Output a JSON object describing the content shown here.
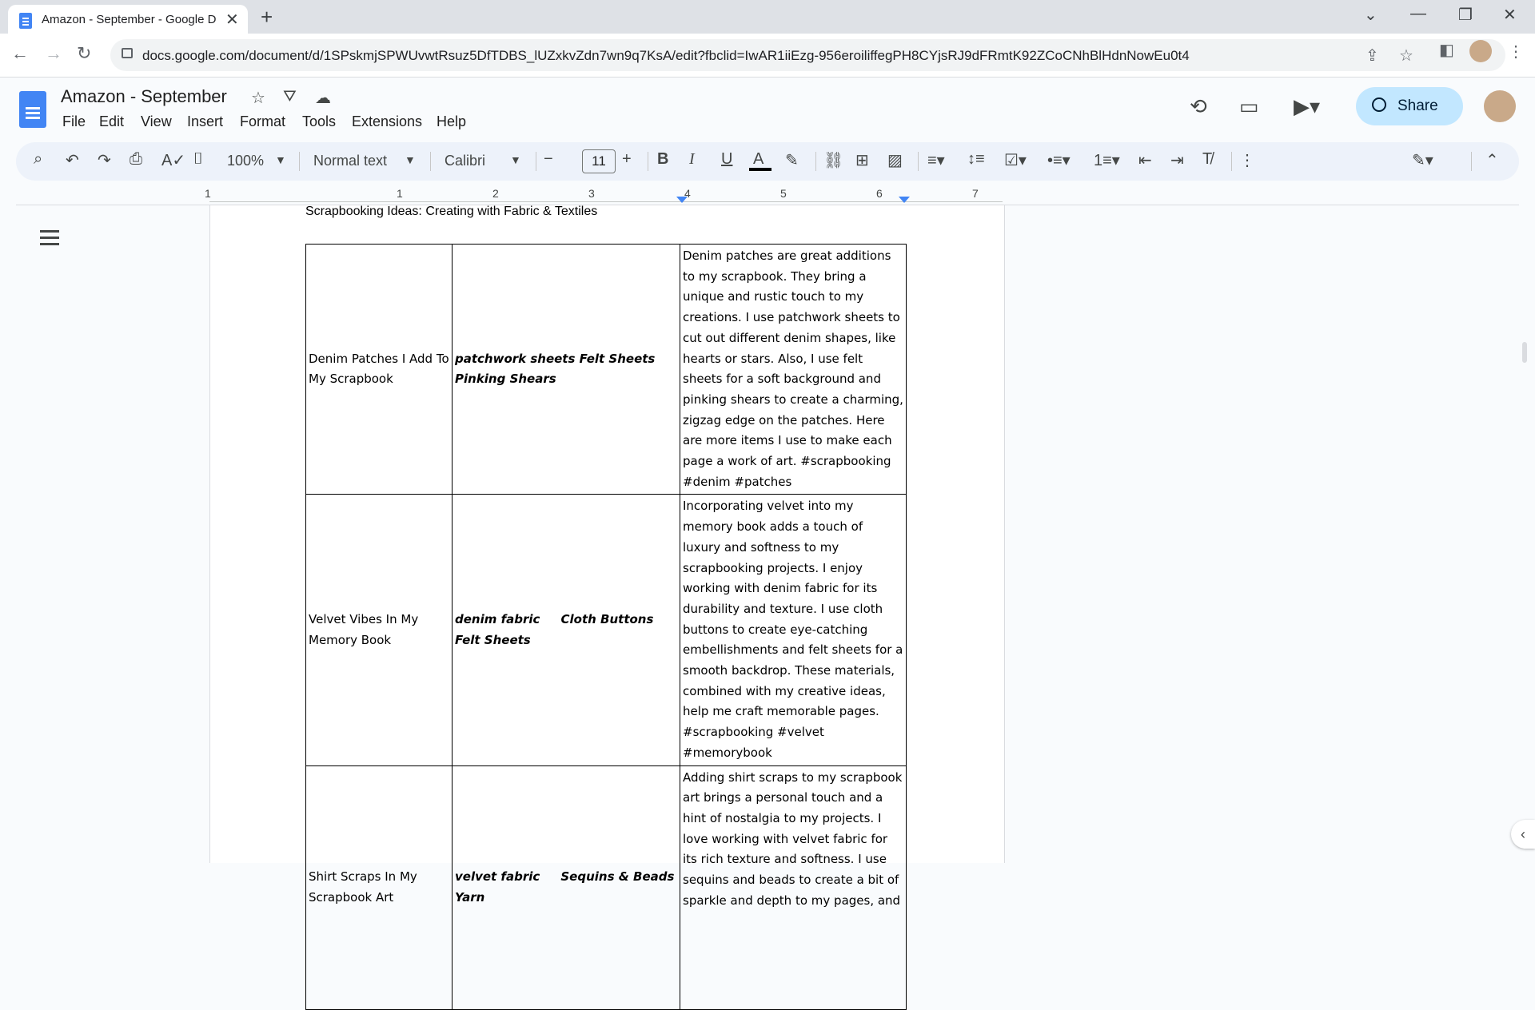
{
  "browser": {
    "tab_title": "Amazon - September - Google D",
    "url": "docs.google.com/document/d/1SPskmjSPWUvwtRsuz5DfTDBS_lUZxkvZdn7wn9q7KsA/edit?fbclid=IwAR1iiEzg-956eroiliffegPH8CYjsRJ9dFRmtK92ZCoCNhBlHdnNowEu0t4"
  },
  "docs": {
    "title": "Amazon - September",
    "menu": [
      "File",
      "Edit",
      "View",
      "Insert",
      "Format",
      "Tools",
      "Extensions",
      "Help"
    ],
    "share_label": "Share"
  },
  "toolbar": {
    "zoom": "100%",
    "style": "Normal text",
    "font": "Calibri",
    "font_size": "11"
  },
  "ruler": {
    "numbers": [
      "1",
      "1",
      "2",
      "3",
      "4",
      "5",
      "6",
      "7"
    ]
  },
  "document": {
    "heading": "Scrapbooking Ideas: Creating with Fabric & Textiles",
    "rows": [
      {
        "title": "Denim Patches I Add To My Scrapbook",
        "materials": "patchwork sheets Felt Sheets Pinking Shears",
        "description": "Denim patches are great additions to my scrapbook. They bring a unique and rustic touch to my creations. I use patchwork sheets to cut out different denim shapes, like hearts or stars. Also, I use felt sheets for a soft background and pinking shears to create a charming, zigzag edge on the patches. Here are more items I use to make each page a work of art. #scrapbooking #denim #patches"
      },
      {
        "title": "Velvet Vibes In My Memory Book",
        "materials": "denim fabric     Cloth Buttons    Felt Sheets",
        "description": "Incorporating velvet into my memory book adds a touch of luxury and softness to my scrapbooking projects. I enjoy working with denim fabric for its durability and texture. I use cloth buttons to create eye-catching embellishments and felt sheets for a smooth backdrop. These materials, combined with my creative ideas, help me craft memorable pages. #scrapbooking #velvet #memorybook"
      },
      {
        "title": "Shirt Scraps In My Scrapbook Art",
        "materials": "velvet fabric     Sequins & Beads           Yarn",
        "description": "Adding shirt scraps to my scrapbook art brings a personal touch and a hint of nostalgia to my projects. I love working with velvet fabric for its rich texture and softness. I use sequins and beads to create a bit of sparkle and depth to my pages, and"
      }
    ]
  }
}
